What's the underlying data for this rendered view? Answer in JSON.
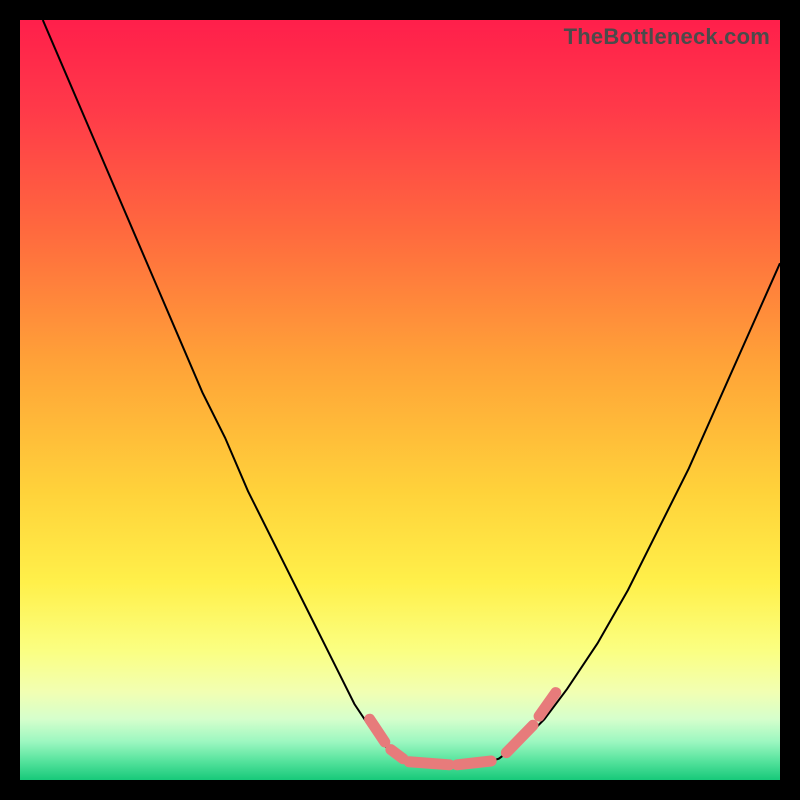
{
  "watermark": "TheBottleneck.com",
  "chart_data": {
    "type": "line",
    "title": "",
    "xlabel": "",
    "ylabel": "",
    "xlim": [
      0,
      100
    ],
    "ylim": [
      0,
      100
    ],
    "grid": false,
    "legend": false,
    "background_gradient_stops": [
      {
        "offset": 0.0,
        "color": "#ff1f4b"
      },
      {
        "offset": 0.12,
        "color": "#ff3a49"
      },
      {
        "offset": 0.28,
        "color": "#ff6a3e"
      },
      {
        "offset": 0.45,
        "color": "#ffa238"
      },
      {
        "offset": 0.62,
        "color": "#ffd23a"
      },
      {
        "offset": 0.74,
        "color": "#fff04a"
      },
      {
        "offset": 0.83,
        "color": "#fbff82"
      },
      {
        "offset": 0.885,
        "color": "#f1ffb3"
      },
      {
        "offset": 0.92,
        "color": "#d5ffcc"
      },
      {
        "offset": 0.95,
        "color": "#9bf7c0"
      },
      {
        "offset": 0.975,
        "color": "#56e39d"
      },
      {
        "offset": 1.0,
        "color": "#17c97a"
      }
    ],
    "series": [
      {
        "name": "left-curve",
        "comment": "Values are bottleneck percentage (y, 0=bottom, 100=top) versus horizontal position (x, 0-100). Approximated from the plot.",
        "x": [
          3,
          6,
          9,
          12,
          15,
          18,
          21,
          24,
          27,
          30,
          33,
          36,
          39,
          42,
          44,
          46,
          48,
          49.5
        ],
        "y": [
          100,
          93,
          86,
          79,
          72,
          65,
          58,
          51,
          45,
          38,
          32,
          26,
          20,
          14,
          10,
          7,
          4.5,
          3
        ]
      },
      {
        "name": "valley-floor",
        "x": [
          49.5,
          52,
          55,
          58,
          61,
          63
        ],
        "y": [
          3,
          2.2,
          2,
          2,
          2.2,
          2.8
        ]
      },
      {
        "name": "right-curve",
        "x": [
          63,
          66,
          69,
          72,
          76,
          80,
          84,
          88,
          92,
          96,
          100
        ],
        "y": [
          2.8,
          5,
          8,
          12,
          18,
          25,
          33,
          41,
          50,
          59,
          68
        ]
      }
    ],
    "markers": {
      "name": "highlight-dashes",
      "color": "#e77b7b",
      "segments": [
        {
          "x1": 46.0,
          "y1": 8.0,
          "x2": 48.0,
          "y2": 5.0
        },
        {
          "x1": 48.8,
          "y1": 4.0,
          "x2": 50.4,
          "y2": 2.8
        },
        {
          "x1": 51.2,
          "y1": 2.4,
          "x2": 56.5,
          "y2": 2.0
        },
        {
          "x1": 57.5,
          "y1": 2.0,
          "x2": 62.0,
          "y2": 2.5
        },
        {
          "x1": 64.0,
          "y1": 3.6,
          "x2": 67.5,
          "y2": 7.2
        },
        {
          "x1": 68.3,
          "y1": 8.4,
          "x2": 70.5,
          "y2": 11.5
        }
      ]
    }
  }
}
